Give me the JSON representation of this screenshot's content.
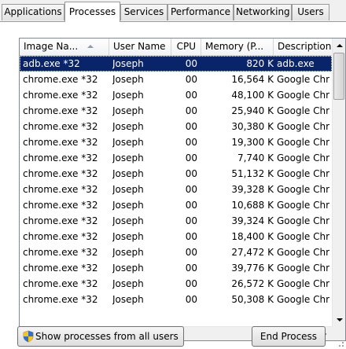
{
  "tabs": [
    {
      "label": "Applications",
      "active": false
    },
    {
      "label": "Processes",
      "active": true
    },
    {
      "label": "Services",
      "active": false
    },
    {
      "label": "Performance",
      "active": false
    },
    {
      "label": "Networking",
      "active": false
    },
    {
      "label": "Users",
      "active": false
    }
  ],
  "table": {
    "columns": [
      "Image Na...",
      "User Name",
      "CPU",
      "Memory (P...",
      "Description"
    ],
    "rows": [
      {
        "image": "adb.exe *32",
        "user": "Joseph",
        "cpu": "00",
        "memory": "820 K",
        "description": "adb.exe",
        "selected": true
      },
      {
        "image": "chrome.exe *32",
        "user": "Joseph",
        "cpu": "00",
        "memory": "16,564 K",
        "description": "Google Chr"
      },
      {
        "image": "chrome.exe *32",
        "user": "Joseph",
        "cpu": "00",
        "memory": "48,100 K",
        "description": "Google Chr"
      },
      {
        "image": "chrome.exe *32",
        "user": "Joseph",
        "cpu": "00",
        "memory": "25,940 K",
        "description": "Google Chr"
      },
      {
        "image": "chrome.exe *32",
        "user": "Joseph",
        "cpu": "00",
        "memory": "30,380 K",
        "description": "Google Chr"
      },
      {
        "image": "chrome.exe *32",
        "user": "Joseph",
        "cpu": "00",
        "memory": "19,300 K",
        "description": "Google Chr"
      },
      {
        "image": "chrome.exe *32",
        "user": "Joseph",
        "cpu": "00",
        "memory": "7,740 K",
        "description": "Google Chr"
      },
      {
        "image": "chrome.exe *32",
        "user": "Joseph",
        "cpu": "00",
        "memory": "51,132 K",
        "description": "Google Chr"
      },
      {
        "image": "chrome.exe *32",
        "user": "Joseph",
        "cpu": "00",
        "memory": "39,328 K",
        "description": "Google Chr"
      },
      {
        "image": "chrome.exe *32",
        "user": "Joseph",
        "cpu": "00",
        "memory": "10,688 K",
        "description": "Google Chr"
      },
      {
        "image": "chrome.exe *32",
        "user": "Joseph",
        "cpu": "00",
        "memory": "39,324 K",
        "description": "Google Chr"
      },
      {
        "image": "chrome.exe *32",
        "user": "Joseph",
        "cpu": "00",
        "memory": "18,400 K",
        "description": "Google Chr"
      },
      {
        "image": "chrome.exe *32",
        "user": "Joseph",
        "cpu": "00",
        "memory": "27,472 K",
        "description": "Google Chr"
      },
      {
        "image": "chrome.exe *32",
        "user": "Joseph",
        "cpu": "00",
        "memory": "39,776 K",
        "description": "Google Chr"
      },
      {
        "image": "chrome.exe *32",
        "user": "Joseph",
        "cpu": "00",
        "memory": "26,572 K",
        "description": "Google Chr"
      },
      {
        "image": "chrome.exe *32",
        "user": "Joseph",
        "cpu": "00",
        "memory": "50,308 K",
        "description": "Google Chr"
      }
    ]
  },
  "buttons": {
    "show_all_users": "Show processes from all users",
    "end_process": "End Process"
  },
  "icons": {
    "sort": "sort-ascending-icon",
    "shield": "uac-shield-icon"
  },
  "colors": {
    "selection": "#0a246a",
    "background": "#f0f0f0"
  }
}
